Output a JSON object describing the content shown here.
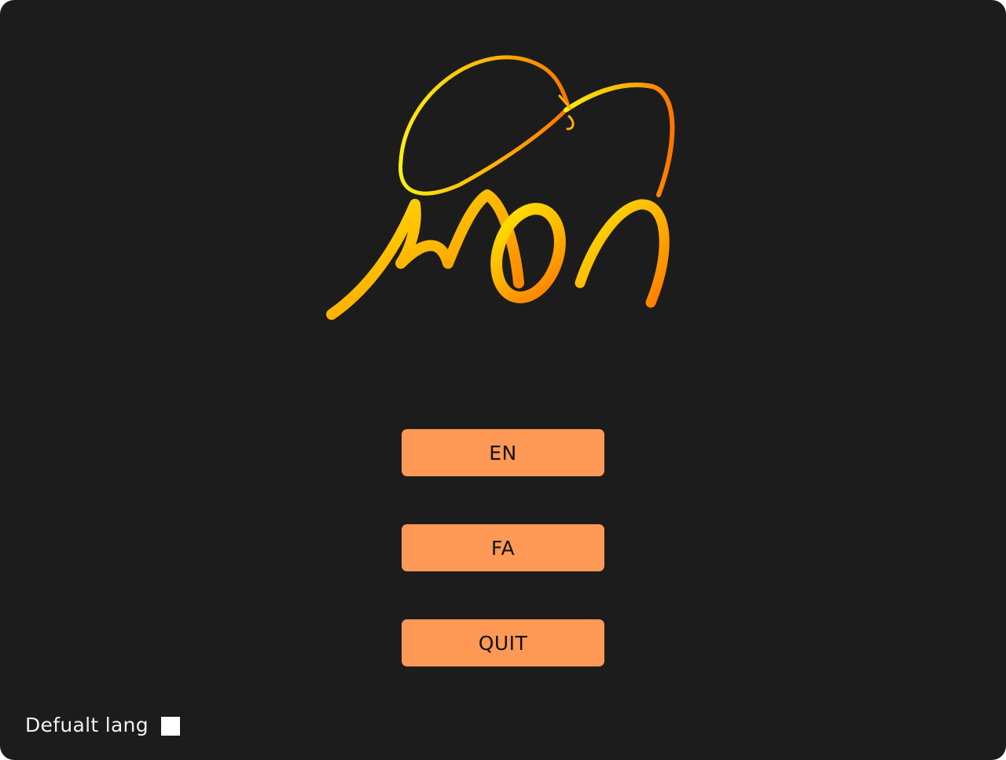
{
  "colors": {
    "background": "#1c1c1c",
    "button_fill": "#ff9955",
    "button_text": "#111111",
    "label_text": "#f2f2f2",
    "logo_gradient_start": "#ffd400",
    "logo_gradient_end": "#ff8a00"
  },
  "logo": {
    "icon": "stylized-script-logo"
  },
  "menu": {
    "en_label": "EN",
    "fa_label": "FA",
    "quit_label": "QUIT"
  },
  "settings": {
    "default_lang_label": "Defualt lang",
    "default_lang_checked": false
  }
}
